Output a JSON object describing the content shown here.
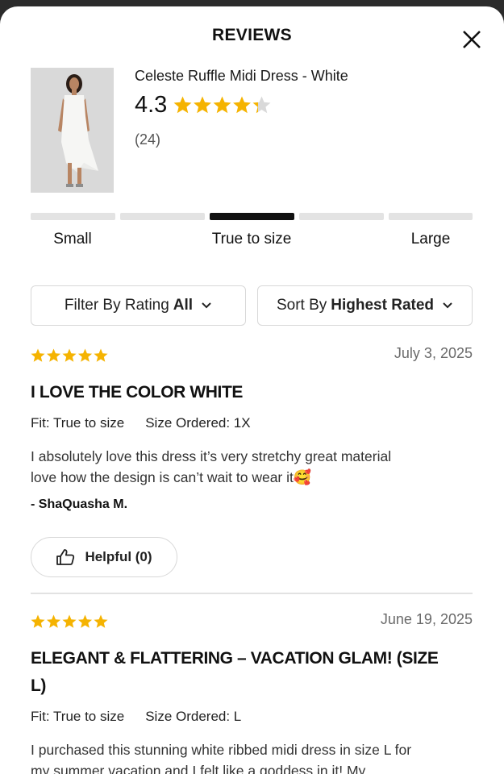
{
  "header": {
    "title": "REVIEWS"
  },
  "product": {
    "name": "Celeste Ruffle Midi Dress - White",
    "rating": "4.3",
    "rating_value": 4.3,
    "review_count": "(24)"
  },
  "fit": {
    "labels": [
      "Small",
      "True to size",
      "Large"
    ],
    "selected_segment": 3,
    "segments": 5
  },
  "filters": {
    "filter_prefix": "Filter By Rating",
    "filter_value": "All",
    "sort_prefix": "Sort By",
    "sort_value": "Highest Rated"
  },
  "reviews": [
    {
      "stars": 5,
      "date": "July 3, 2025",
      "title": "I LOVE THE COLOR WHITE",
      "fit": "Fit: True to size",
      "size": "Size Ordered: 1X",
      "body_line1": "I absolutely love this dress it’s very stretchy great material",
      "body_line2": "love how the design is can’t wait to wear it",
      "emoji": "🥰",
      "author": "- ShaQuasha M.",
      "helpful": "Helpful (0)"
    },
    {
      "stars": 5,
      "date": "June 19, 2025",
      "title_line1": "ELEGANT & FLATTERING – VACATION GLAM! (SIZE",
      "title_line2": "L)",
      "fit": "Fit: True to size",
      "size": "Size Ordered: L",
      "body_line1": "I purchased this stunning white ribbed midi dress in size L for",
      "body_line2": "my summer vacation and I felt like a goddess in it! My"
    }
  ],
  "colors": {
    "star": "#F5B301",
    "star_empty": "#D9D9D9",
    "bar_active": "#111111",
    "bar_inactive": "#E3E3E3"
  }
}
